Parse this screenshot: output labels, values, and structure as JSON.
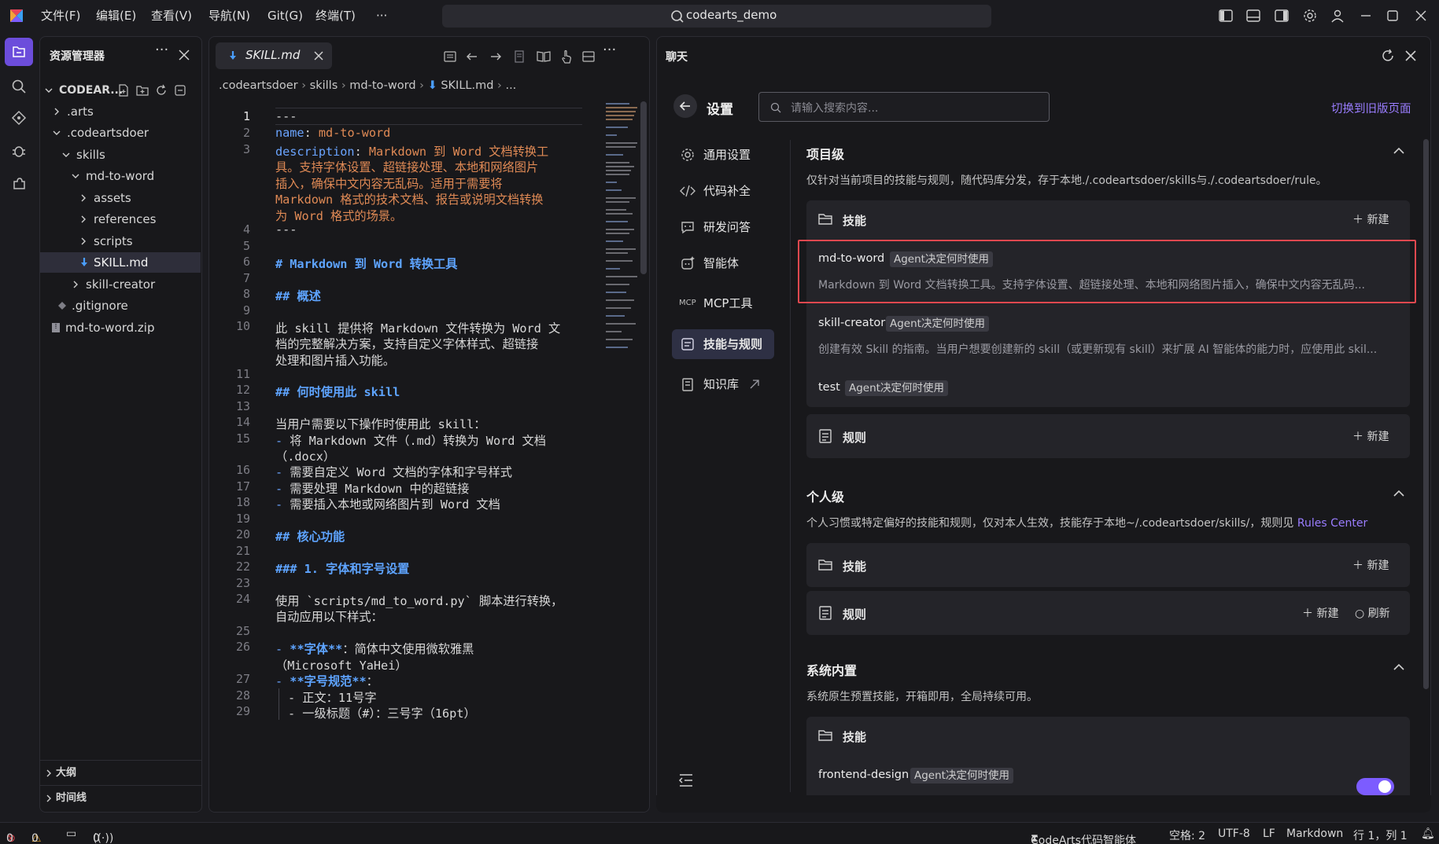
{
  "titlebar": {
    "menus": [
      "文件(F)",
      "编辑(E)",
      "查看(V)",
      "导航(N)",
      "Git(G)",
      "终端(T)",
      "···"
    ],
    "search_text": "codearts_demo"
  },
  "explorer": {
    "title": "资源管理器",
    "root": "CODEAR...",
    "items": [
      ".arts",
      ".codeartsdoer",
      "skills",
      "md-to-word",
      "assets",
      "references",
      "scripts",
      "SKILL.md",
      "skill-creator",
      ".gitignore",
      "md-to-word.zip"
    ],
    "outline": "大纲",
    "timeline": "时间线"
  },
  "editor": {
    "tab_label": "SKILL.md",
    "breadcrumb": [
      ".codeartsdoer",
      "skills",
      "md-to-word",
      "SKILL.md",
      "..."
    ],
    "line_numbers": [
      "1",
      "2",
      "3",
      "4",
      "5",
      "6",
      "7",
      "8",
      "9",
      "10",
      "11",
      "12",
      "13",
      "14",
      "15",
      "16",
      "17",
      "18",
      "19",
      "20",
      "21",
      "22",
      "23",
      "24",
      "25",
      "26",
      "27",
      "28",
      "29"
    ],
    "lines": {
      "l1": "---",
      "l2k": "name",
      "l2v": "md-to-word",
      "l3k": "description",
      "l3a": "Markdown 到 Word 文档转换工",
      "l3b": "具。支持字体设置、超链接处理、本地和网络图片",
      "l3c": "插入，确保中文内容无乱码。适用于需要将",
      "l3d": "Markdown 格式的技术文档、报告或说明文档转换",
      "l3e": "为 Word 格式的场景。",
      "l4": "---",
      "l6": "# Markdown 到 Word 转换工具",
      "l8": "## 概述",
      "l10a": "此 skill 提供将 Markdown 文件转换为 Word 文",
      "l10b": "档的完整解决方案，支持自定义字体样式、超链接",
      "l10c": "处理和图片插入功能。",
      "l12": "## 何时使用此 skill",
      "l14": "当用户需要以下操作时使用此 skill：",
      "l15a": "将 Markdown 文件（.md）转换为 Word 文档",
      "l15b": "（.docx）",
      "l16": "需要自定义 Word 文档的字体和字号样式",
      "l17": "需要处理 Markdown 中的超链接",
      "l18": "需要插入本地或网络图片到 Word 文档",
      "l20": "## 核心功能",
      "l22": "### 1. 字体和字号设置",
      "l24a": "使用 `scripts/md_to_word.py` 脚本进行转换，",
      "l24b": "自动应用以下样式：",
      "l26a": "**字体**",
      "l26b": "：简体中文使用微软雅黑",
      "l26c": "（Microsoft YaHei）",
      "l27a": "**字号规范**",
      "l27b": "：",
      "l28": "- 正文：11号字",
      "l29": "- 一级标题（#）：三号字（16pt）"
    }
  },
  "chat": {
    "panel_title": "聊天",
    "settings_title": "设置",
    "search_placeholder": "请输入搜索内容...",
    "switch_old": "切换到旧版页面",
    "nav": [
      "通用设置",
      "代码补全",
      "研发问答",
      "智能体",
      "MCP工具",
      "技能与规则",
      "知识库"
    ],
    "project": {
      "title": "项目级",
      "desc": "仅针对当前项目的技能与规则，随代码库分发，存于本地./.codeartsdoer/skills与./.codeartsdoer/rule。",
      "skills_label": "技能",
      "new": "新建",
      "skills": [
        {
          "name": "md-to-word",
          "badge": "Agent决定何时使用",
          "desc": "Markdown 到 Word 文档转换工具。支持字体设置、超链接处理、本地和网络图片插入，确保中文内容无乱码..."
        },
        {
          "name": "skill-creator",
          "badge": "Agent决定何时使用",
          "desc": "创建有效 Skill 的指南。当用户想要创建新的 skill（或更新现有 skill）来扩展 AI 智能体的能力时，应使用此 skil..."
        },
        {
          "name": "test",
          "badge": "Agent决定何时使用"
        }
      ],
      "rules_label": "规则"
    },
    "personal": {
      "title": "个人级",
      "desc": "个人习惯或特定偏好的技能和规则，仅对本人生效，技能存于本地~/.codeartsdoer/skills/，规则见",
      "link": "Rules Center",
      "skills_label": "技能",
      "rules_label": "规则",
      "new": "新建",
      "refresh": "刷新"
    },
    "system": {
      "title": "系统内置",
      "desc": "系统原生预置技能，开箱即用，全局持续可用。",
      "skills_label": "技能",
      "skills": [
        {
          "name": "frontend-design",
          "badge": "Agent决定何时使用"
        }
      ]
    }
  },
  "statusbar": {
    "errors": "0",
    "warnings": "0",
    "ports": "0",
    "agent": "CodeArts代码智能体",
    "spaces": "空格: 2",
    "encoding": "UTF-8",
    "eol": "LF",
    "language": "Markdown",
    "position": "行 1，列 1"
  },
  "colors": {
    "accent": "#7c5cff",
    "highlight_border": "#e0484f",
    "link": "#9a7dff"
  }
}
